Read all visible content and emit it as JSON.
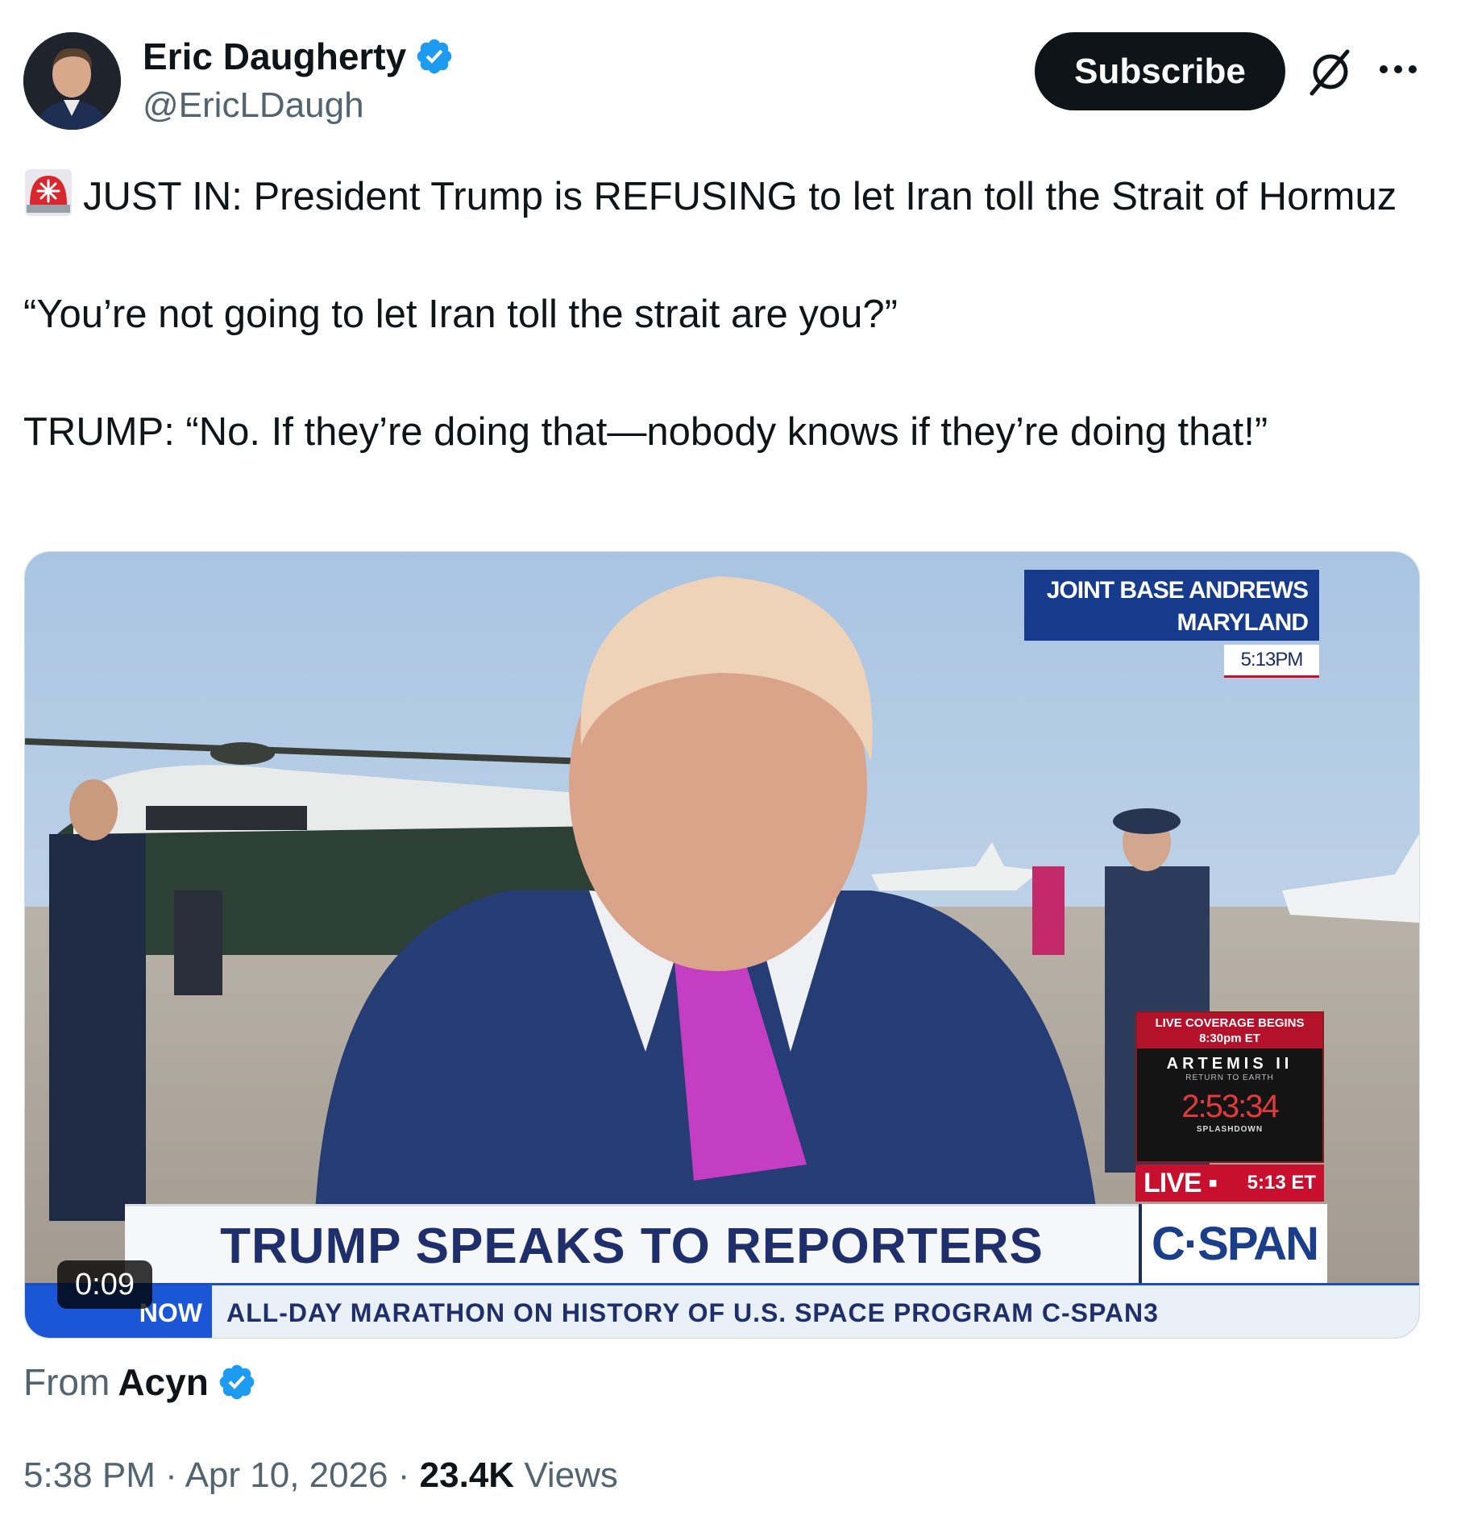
{
  "author": {
    "name": "Eric Daugherty",
    "handle": "@EricLDaugh",
    "verified": true
  },
  "actions": {
    "subscribe_label": "Subscribe",
    "grok_icon": "grok-icon",
    "more_icon": "more-icon"
  },
  "tweet": {
    "line1": "JUST IN: President Trump is REFUSING to let Iran toll the Strait of Hormuz",
    "line2": "“You’re not going to let Iran toll the strait are you?”",
    "line3": "TRUMP: “No. If they’re doing that—nobody knows if they’re doing that!”",
    "emoji": "rotating-light"
  },
  "video": {
    "duration": "0:09",
    "chyron": "TRUMP SPEAKS TO REPORTERS",
    "network": "C·SPAN",
    "location_line1": "JOINT BASE ANDREWS",
    "location_line2": "MARYLAND",
    "location_time": "5:13PM",
    "live_label": "LIVE ▪",
    "live_time": "5:13 ET",
    "coverage_header": "LIVE COVERAGE BEGINS 8:30pm ET",
    "coverage_title": "ARTEMIS II",
    "coverage_sub": "RETURN TO EARTH",
    "coverage_countdown": "2:53:34",
    "coverage_footer": "SPLASHDOWN",
    "ticker_label": "NOW",
    "ticker_text": "ALL-DAY MARATHON ON HISTORY OF U.S. SPACE PROGRAM C-SPAN3"
  },
  "source": {
    "prefix": "From",
    "name": "Acyn",
    "verified": true
  },
  "meta": {
    "time": "5:38 PM",
    "date": "Apr 10, 2026",
    "views_count": "23.4K",
    "views_label": "Views"
  },
  "colors": {
    "verified": "#1d9bf0",
    "text": "#0f1419",
    "secondary": "#536471",
    "subscribe_bg": "#0f1419"
  }
}
